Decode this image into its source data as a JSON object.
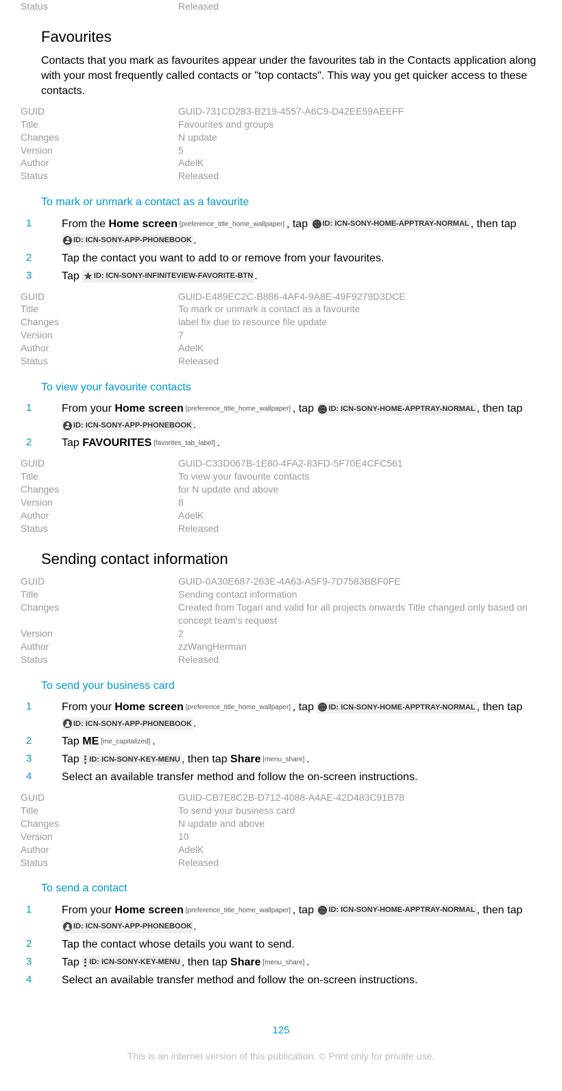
{
  "top_meta": [
    {
      "label": "Status",
      "value": "Released"
    }
  ],
  "favourites": {
    "title": "Favourites",
    "para": "Contacts that you mark as favourites appear under the favourites tab in the Contacts application along with your most frequently called contacts or \"top contacts\". This way you get quicker access to these contacts.",
    "meta": [
      {
        "label": "GUID",
        "value": "GUID-731CD283-B219-4557-A6C9-D42EE59AEEFF"
      },
      {
        "label": "Title",
        "value": "Favourites and groups"
      },
      {
        "label": "Changes",
        "value": "N update"
      },
      {
        "label": "Version",
        "value": "5"
      },
      {
        "label": "Author",
        "value": "AdelK"
      },
      {
        "label": "Status",
        "value": "Released"
      }
    ]
  },
  "mark_fav": {
    "title": "To mark or unmark a contact as a favourite",
    "step1_a": "From the ",
    "step1_b": "Home screen",
    "step1_tag1": " [preference_title_home_wallpaper] ",
    "step1_c": ", tap ",
    "step1_chip1": " ID: ICN-SONY-HOME-APPTRAY-NORMAL ",
    "step1_d": ", then tap ",
    "step1_chip2": " ID: ICN-SONY-APP-PHONEBOOK ",
    "step1_e": ".",
    "step2": "Tap the contact you want to add to or remove from your favourites.",
    "step3_a": "Tap ",
    "step3_chip": " ID: ICN-SONY-INFINITEVIEW-FAVORITE-BTN ",
    "step3_b": ".",
    "meta": [
      {
        "label": "GUID",
        "value": "GUID-E489EC2C-B886-4AF4-9A8E-49F9279D3DCE"
      },
      {
        "label": "Title",
        "value": "To mark or unmark a contact as a favourite"
      },
      {
        "label": "Changes",
        "value": "label fix due to resource file update"
      },
      {
        "label": "Version",
        "value": "7"
      },
      {
        "label": "Author",
        "value": "AdelK"
      },
      {
        "label": "Status",
        "value": "Released"
      }
    ]
  },
  "view_fav": {
    "title": "To view your favourite contacts",
    "step1_a": "From your ",
    "step1_b": "Home screen",
    "step1_tag1": " [preference_title_home_wallpaper] ",
    "step1_c": ", tap ",
    "step1_chip1": " ID: ICN-SONY-HOME-APPTRAY-NORMAL ",
    "step1_d": ", then tap ",
    "step1_chip2": " ID: ICN-SONY-APP-PHONEBOOK ",
    "step1_e": ".",
    "step2_a": "Tap ",
    "step2_b": "FAVOURITES",
    "step2_tag": " [favorites_tab_label] ",
    "step2_c": ".",
    "meta": [
      {
        "label": "GUID",
        "value": "GUID-C33D067B-1E80-4FA2-83FD-5F70E4CFC561"
      },
      {
        "label": "Title",
        "value": "To view your favourite contacts"
      },
      {
        "label": "Changes",
        "value": "for N update and above"
      },
      {
        "label": "Version",
        "value": "8"
      },
      {
        "label": "Author",
        "value": "AdelK"
      },
      {
        "label": "Status",
        "value": "Released"
      }
    ]
  },
  "send_info": {
    "title": "Sending contact information",
    "meta": [
      {
        "label": "GUID",
        "value": "GUID-0A30E687-263E-4A63-A5F9-7D7583BBF0FE"
      },
      {
        "label": "Title",
        "value": "Sending contact information"
      },
      {
        "label": "Changes",
        "value": "Created from Togari and valid for all projects onwards Title changed only based on concept team's request"
      },
      {
        "label": "Version",
        "value": "2"
      },
      {
        "label": "Author",
        "value": "zzWangHerman"
      },
      {
        "label": "Status",
        "value": "Released"
      }
    ]
  },
  "send_card": {
    "title": "To send your business card",
    "step1_a": "From your ",
    "step1_b": "Home screen",
    "step1_tag1": " [preference_title_home_wallpaper] ",
    "step1_c": ", tap ",
    "step1_chip1": " ID: ICN-SONY-HOME-APPTRAY-NORMAL ",
    "step1_d": ", then tap ",
    "step1_chip2": " ID: ICN-SONY-APP-PHONEBOOK ",
    "step1_e": ".",
    "step2_a": "Tap ",
    "step2_b": "ME",
    "step2_tag": " [me_capitalized] ",
    "step2_c": ".",
    "step3_a": "Tap ",
    "step3_chip": "ID: ICN-SONY-KEY-MENU ",
    "step3_b": ", then tap ",
    "step3_c": "Share",
    "step3_tag": " [menu_share] ",
    "step3_d": ".",
    "step4": "Select an available transfer method and follow the on-screen instructions.",
    "meta": [
      {
        "label": "GUID",
        "value": "GUID-CB7E8C2B-D712-4088-A4AE-42D483C91B78"
      },
      {
        "label": "Title",
        "value": "To send your business card"
      },
      {
        "label": "Changes",
        "value": "N update and above"
      },
      {
        "label": "Version",
        "value": "10"
      },
      {
        "label": "Author",
        "value": "AdelK"
      },
      {
        "label": "Status",
        "value": "Released"
      }
    ]
  },
  "send_contact": {
    "title": "To send a contact",
    "step1_a": "From your ",
    "step1_b": "Home screen",
    "step1_tag1": " [preference_title_home_wallpaper] ",
    "step1_c": ", tap ",
    "step1_chip1": " ID: ICN-SONY-HOME-APPTRAY-NORMAL ",
    "step1_d": ", then tap ",
    "step1_chip2": " ID: ICN-SONY-APP-PHONEBOOK ",
    "step1_e": ".",
    "step2": "Tap the contact whose details you want to send.",
    "step3_a": "Tap ",
    "step3_chip": "ID: ICN-SONY-KEY-MENU ",
    "step3_b": ", then tap ",
    "step3_c": "Share",
    "step3_tag": " [menu_share] ",
    "step3_d": ".",
    "step4": "Select an available transfer method and follow the on-screen instructions."
  },
  "page": "125",
  "footer": "This is an internet version of this publication. © Print only for private use."
}
